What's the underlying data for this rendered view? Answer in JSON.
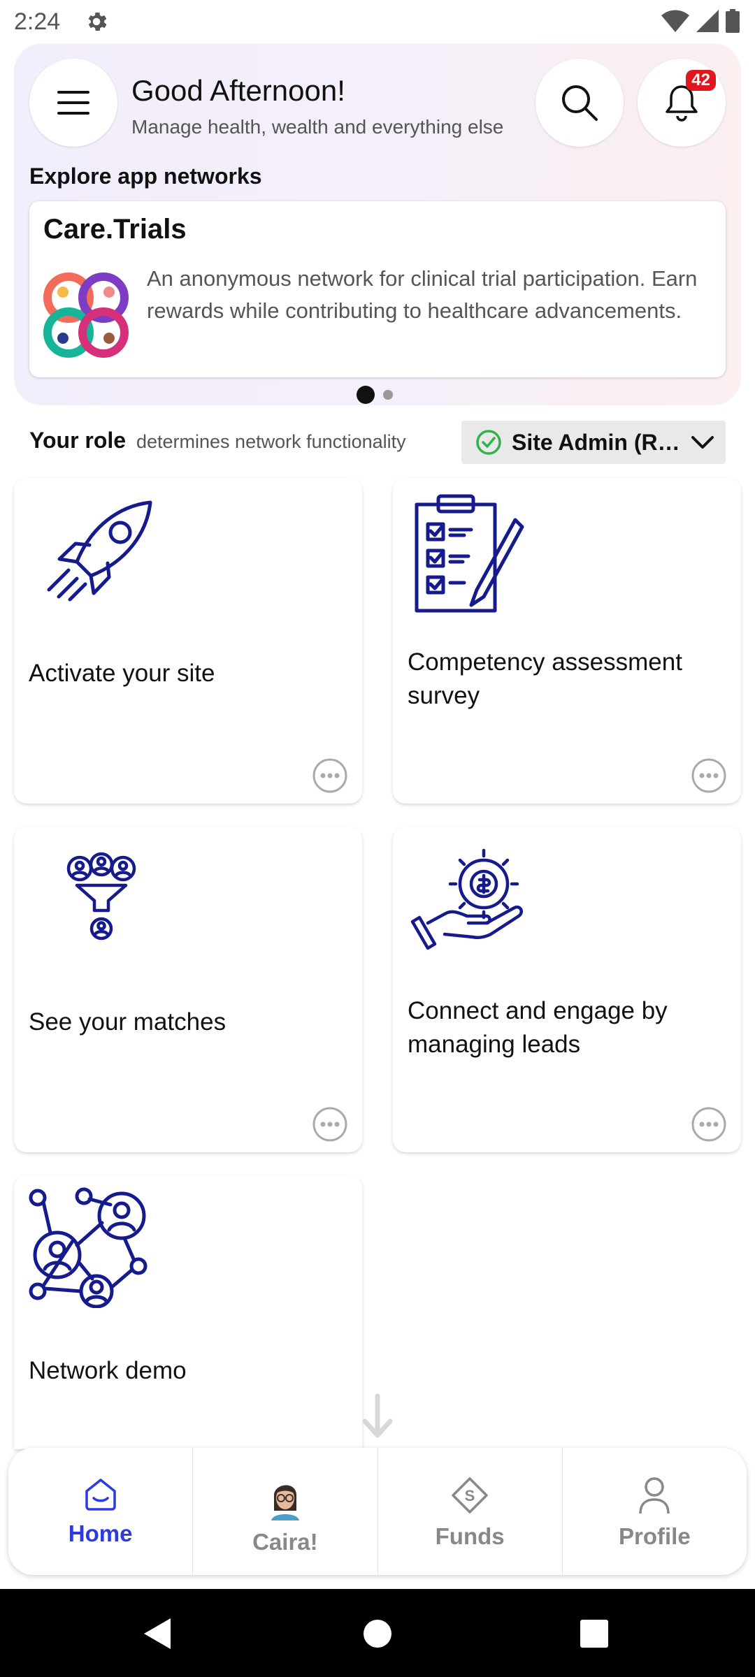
{
  "status_bar": {
    "time": "2:24"
  },
  "header": {
    "greeting": "Good Afternoon!",
    "subtitle": "Manage health, wealth and everything else",
    "notification_count": "42"
  },
  "explore": {
    "label": "Explore app networks",
    "card": {
      "title": "Care.Trials",
      "description": "An anonymous network for clinical trial participation. Earn rewards while contributing to healthcare advancements."
    },
    "pages": 2,
    "active_page": 1
  },
  "role": {
    "label": "Your role",
    "hint": "determines network functionality",
    "selected": "Site Admin (Re..."
  },
  "tiles": [
    {
      "label": "Activate your site",
      "icon": "rocket-icon"
    },
    {
      "label": "Competency assessment survey",
      "icon": "clipboard-checklist-icon"
    },
    {
      "label": "See your matches",
      "icon": "people-filter-icon"
    },
    {
      "label": "Connect and engage by managing leads",
      "icon": "hand-coin-gear-icon"
    },
    {
      "label": "Network demo",
      "icon": "network-people-icon"
    }
  ],
  "nav": {
    "items": [
      {
        "label": "Home",
        "icon": "home-icon",
        "active": true
      },
      {
        "label": "Caira!",
        "icon": "avatar"
      },
      {
        "label": "Funds",
        "icon": "funds-icon"
      },
      {
        "label": "Profile",
        "icon": "profile-icon"
      }
    ]
  },
  "colors": {
    "accent": "#2b3be0",
    "icon_navy": "#151a8c",
    "badge": "#e0171e",
    "check_green": "#2fb34a"
  }
}
